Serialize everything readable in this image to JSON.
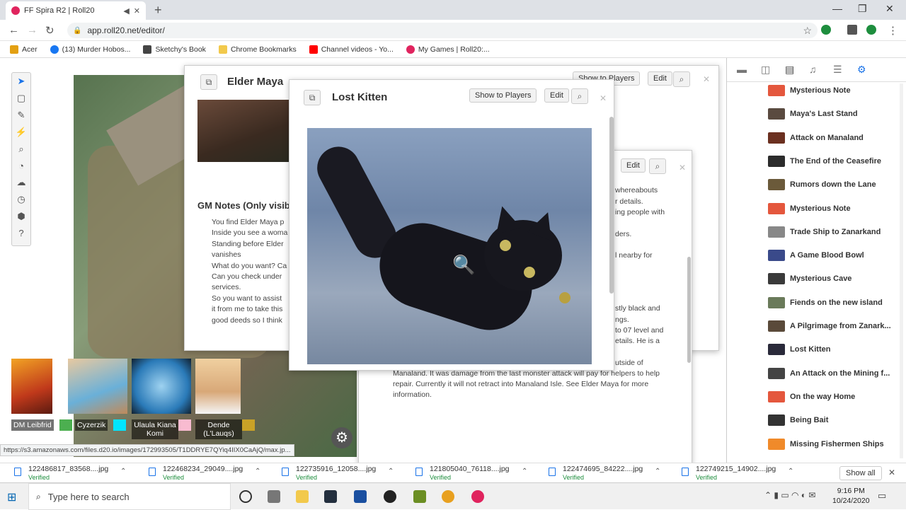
{
  "browser": {
    "tab_title": "FF Spira R2 | Roll20",
    "tab_close": "✕",
    "new_tab": "+",
    "url": "app.roll20.net/editor/",
    "bookmarks": [
      {
        "label": "Acer",
        "color": "#e3a012"
      },
      {
        "label": "(13) Murder Hobos...",
        "color": "#1877f2"
      },
      {
        "label": "Sketchy's Book",
        "color": "#444444"
      },
      {
        "label": "Chrome Bookmarks",
        "color": "#f2c94c"
      },
      {
        "label": "Channel videos - Yo...",
        "color": "#ff0000"
      },
      {
        "label": "My Games | Roll20:...",
        "color": "#e0245e"
      }
    ]
  },
  "handouts": {
    "elder": {
      "title": "Elder Maya",
      "show_to_players": "Show to Players",
      "edit": "Edit",
      "gm_notes_title": "GM Notes (Only visib",
      "gm_notes": [
        "You find Elder Maya p",
        "Inside you see a woma",
        "Standing before Elder",
        "vanishes",
        "What do you want? Ca",
        "Can you check under",
        "services.",
        "So you want to assist",
        "it from me to take this",
        "good deeds so I think"
      ]
    },
    "middle": {
      "edit": "Edit",
      "fragments": [
        "whereabouts",
        "r details.",
        "ing people with",
        "ders.",
        "l nearby for",
        "stly black and",
        "ngs.",
        "to 07 level and",
        "etails. He is a",
        "utside of",
        "Manaland. It was damage from the last monster attack will pay for helpers to help",
        "repair. Currently it will not retract into Manaland Isle. See Elder Maya for more",
        "information."
      ]
    },
    "kitten": {
      "title": "Lost Kitten",
      "show_to_players": "Show to Players",
      "edit": "Edit"
    }
  },
  "players": [
    {
      "name": "DM Leibfrid",
      "color": "#4caf50"
    },
    {
      "name": "Cyzerzik",
      "color": "#00e5ff"
    },
    {
      "name": "Ulaula Kiana Komi",
      "color": "#f8bbd0"
    },
    {
      "name": "Dende (L'Lauqs)",
      "color": "#c9a227"
    }
  ],
  "journal": [
    {
      "label": "Mysterious Note",
      "color": "#e4573d"
    },
    {
      "label": "Maya's Last Stand",
      "color": "#5a4a40"
    },
    {
      "label": "Attack on Manaland",
      "color": "#6b3020"
    },
    {
      "label": "The End of the Ceasefire",
      "color": "#2c2c2c"
    },
    {
      "label": "Rumors down the Lane",
      "color": "#6b5a3a"
    },
    {
      "label": "Mysterious Note",
      "color": "#e4573d"
    },
    {
      "label": "Trade Ship to Zanarkand",
      "color": "#888888"
    },
    {
      "label": "A Game Blood Bowl",
      "color": "#3a4a8a"
    },
    {
      "label": "Mysterious Cave",
      "color": "#3a3a3a"
    },
    {
      "label": "Fiends on the new island",
      "color": "#6a7a5a"
    },
    {
      "label": "A Pilgrimage from Zanark...",
      "color": "#5a4a3a"
    },
    {
      "label": "Lost Kitten",
      "color": "#2a2a3a"
    },
    {
      "label": "An Attack on the Mining f...",
      "color": "#444444"
    },
    {
      "label": "On the way Home",
      "color": "#e4573d"
    },
    {
      "label": "Being Bait",
      "color": "#333333"
    },
    {
      "label": "Missing Fishermen Ships",
      "color": "#f08a2a"
    }
  ],
  "status_url": "https://s3.amazonaws.com/files.d20.io/images/172993505/T1DDRYE7QYiq4IIX0CaAjQ/max.jp...",
  "downloads": [
    {
      "name": "122486817_83568....jpg",
      "status": "Verified"
    },
    {
      "name": "122468234_29049....jpg",
      "status": "Verified"
    },
    {
      "name": "122735916_12058....jpg",
      "status": "Verified"
    },
    {
      "name": "121805040_76118....jpg",
      "status": "Verified"
    },
    {
      "name": "122474695_84222....jpg",
      "status": "Verified"
    },
    {
      "name": "122749215_14902....jpg",
      "status": "Verified"
    }
  ],
  "show_all": "Show all",
  "taskbar": {
    "search_placeholder": "Type here to search",
    "time": "9:16 PM",
    "date": "10/24/2020"
  },
  "colors": {
    "accent": "#1a73e8",
    "ext_green": "#1e8e3e"
  }
}
